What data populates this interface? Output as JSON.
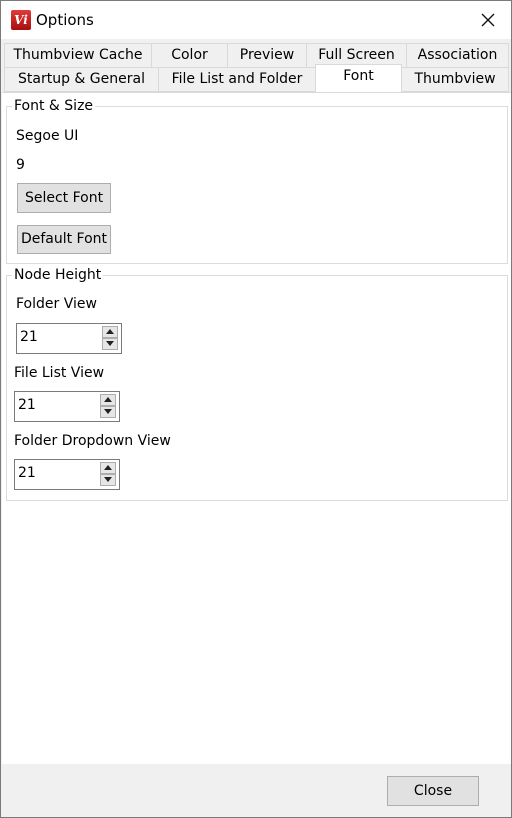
{
  "window": {
    "title": "Options",
    "app_icon_text": "Vi"
  },
  "tabs_row1": [
    {
      "label": "Thumbview Cache"
    },
    {
      "label": "Color"
    },
    {
      "label": "Preview"
    },
    {
      "label": "Full Screen"
    },
    {
      "label": "Association"
    }
  ],
  "tabs_row2": [
    {
      "label": "Startup & General"
    },
    {
      "label": "File List and Folder"
    },
    {
      "label": "Font",
      "active": true
    },
    {
      "label": "Thumbview"
    }
  ],
  "font_size": {
    "group_title": "Font & Size",
    "font_name": "Segoe UI",
    "font_size": "9",
    "select_font_label": "Select Font",
    "default_font_label": "Default Font"
  },
  "node_height": {
    "group_title": "Node Height",
    "folder_view_label": "Folder View",
    "folder_view_value": "21",
    "file_list_view_label": "File List View",
    "file_list_view_value": "21",
    "folder_dropdown_view_label": "Folder Dropdown View",
    "folder_dropdown_view_value": "21"
  },
  "footer": {
    "close_label": "Close"
  }
}
